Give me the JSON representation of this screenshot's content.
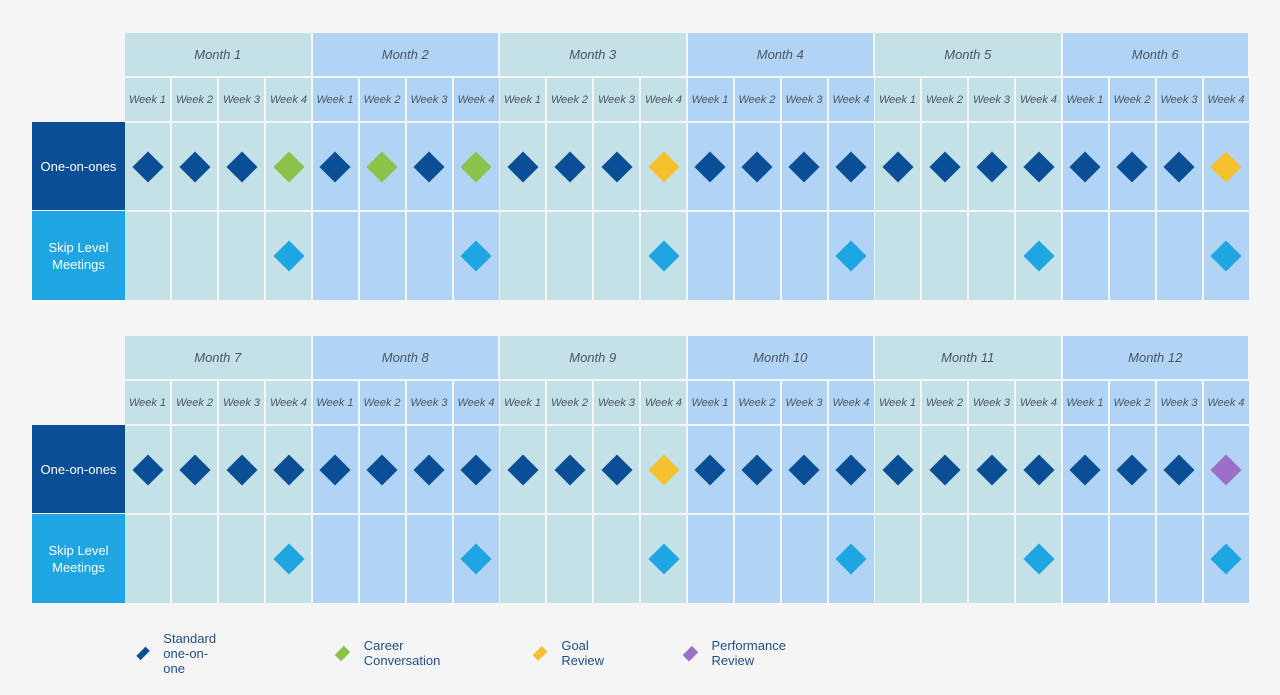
{
  "row_labels": {
    "one_on_ones": "One-on-ones",
    "skip_level": "Skip Level Meetings"
  },
  "week_labels": [
    "Week 1",
    "Week 2",
    "Week 3",
    "Week 4"
  ],
  "colors": {
    "standard": "#0a4f96",
    "career": "#8bc34a",
    "goal": "#f5c12e",
    "performance": "#9c6fc9",
    "skip": "#1fa6e2",
    "month_even_bg": "#c3e1e6",
    "month_odd_bg": "#b2d4f4"
  },
  "blocks": [
    {
      "months": [
        {
          "label": "Month 1",
          "one_on_ones": [
            "standard",
            "standard",
            "standard",
            "career"
          ],
          "skip": [
            null,
            null,
            null,
            "skip"
          ]
        },
        {
          "label": "Month 2",
          "one_on_ones": [
            "standard",
            "career",
            "standard",
            "career"
          ],
          "skip": [
            null,
            null,
            null,
            "skip"
          ]
        },
        {
          "label": "Month 3",
          "one_on_ones": [
            "standard",
            "standard",
            "standard",
            "goal"
          ],
          "skip": [
            null,
            null,
            null,
            "skip"
          ]
        },
        {
          "label": "Month 4",
          "one_on_ones": [
            "standard",
            "standard",
            "standard",
            "standard"
          ],
          "skip": [
            null,
            null,
            null,
            "skip"
          ]
        },
        {
          "label": "Month 5",
          "one_on_ones": [
            "standard",
            "standard",
            "standard",
            "standard"
          ],
          "skip": [
            null,
            null,
            null,
            "skip"
          ]
        },
        {
          "label": "Month 6",
          "one_on_ones": [
            "standard",
            "standard",
            "standard",
            "goal"
          ],
          "skip": [
            null,
            null,
            null,
            "skip"
          ]
        }
      ]
    },
    {
      "months": [
        {
          "label": "Month 7",
          "one_on_ones": [
            "standard",
            "standard",
            "standard",
            "standard"
          ],
          "skip": [
            null,
            null,
            null,
            "skip"
          ]
        },
        {
          "label": "Month 8",
          "one_on_ones": [
            "standard",
            "standard",
            "standard",
            "standard"
          ],
          "skip": [
            null,
            null,
            null,
            "skip"
          ]
        },
        {
          "label": "Month 9",
          "one_on_ones": [
            "standard",
            "standard",
            "standard",
            "goal"
          ],
          "skip": [
            null,
            null,
            null,
            "skip"
          ]
        },
        {
          "label": "Month 10",
          "one_on_ones": [
            "standard",
            "standard",
            "standard",
            "standard"
          ],
          "skip": [
            null,
            null,
            null,
            "skip"
          ]
        },
        {
          "label": "Month 11",
          "one_on_ones": [
            "standard",
            "standard",
            "standard",
            "standard"
          ],
          "skip": [
            null,
            null,
            null,
            "skip"
          ]
        },
        {
          "label": "Month 12",
          "one_on_ones": [
            "standard",
            "standard",
            "standard",
            "performance"
          ],
          "skip": [
            null,
            null,
            null,
            "skip"
          ]
        }
      ]
    }
  ],
  "legend": [
    {
      "key": "standard",
      "label": "Standard one-on-one"
    },
    {
      "key": "career",
      "label": "Career Conversation"
    },
    {
      "key": "goal",
      "label": "Goal Review"
    },
    {
      "key": "performance",
      "label": "Performance Review"
    }
  ]
}
